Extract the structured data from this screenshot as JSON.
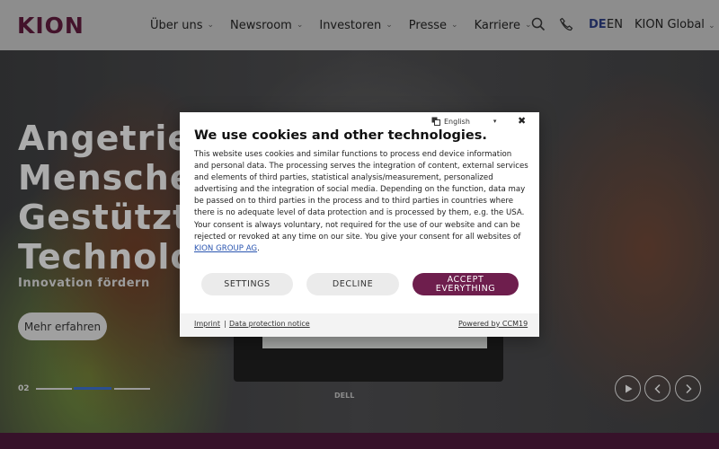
{
  "header": {
    "logo": "KION",
    "nav": [
      {
        "label": "Über uns"
      },
      {
        "label": "Newsroom"
      },
      {
        "label": "Investoren"
      },
      {
        "label": "Presse"
      },
      {
        "label": "Karriere"
      }
    ],
    "icons": [
      "search-icon",
      "phone-icon"
    ],
    "languages": [
      {
        "label": "DE",
        "active": true
      },
      {
        "label": "EN",
        "active": false
      }
    ],
    "global_label": "KION Global"
  },
  "hero": {
    "title": "Angetrieben von\nMenschen.\nGestützt durch\nTechnologie.",
    "subtitle": "Innovation fördern",
    "cta": "Mehr erfahren",
    "slide_number": "02",
    "laptop_brand": "DELL"
  },
  "cookie_dialog": {
    "language": "English",
    "title": "We use cookies and other technologies.",
    "body": "This website uses cookies and similar functions to process end device information and personal data. The processing serves the integration of content, external services and elements of third parties, statistical analysis/measurement, personalized advertising and the integration of social media. Depending on the function, data may be passed on to third parties in the process and to third parties in countries where there is no adequate level of data protection and is processed by them, e.g. the USA. Your consent is always voluntary, not required for the use of our website and can be rejected or revoked at any time on our site. You give your consent for all websites of ",
    "body_link": "KION GROUP AG",
    "body_end": ".",
    "settings_label": "SETTINGS",
    "decline_label": "DECLINE",
    "accept_label": "ACCEPT\nEVERYTHING",
    "imprint_label": "Imprint",
    "separator": "|",
    "privacy_label": "Data protection notice",
    "powered_label": "Powered by CCM19"
  },
  "colors": {
    "brand": "#5a1a3a",
    "accept": "#6e1e4d",
    "lang_active": "#2a3a7a",
    "progress_active": "#3a6ac0"
  }
}
